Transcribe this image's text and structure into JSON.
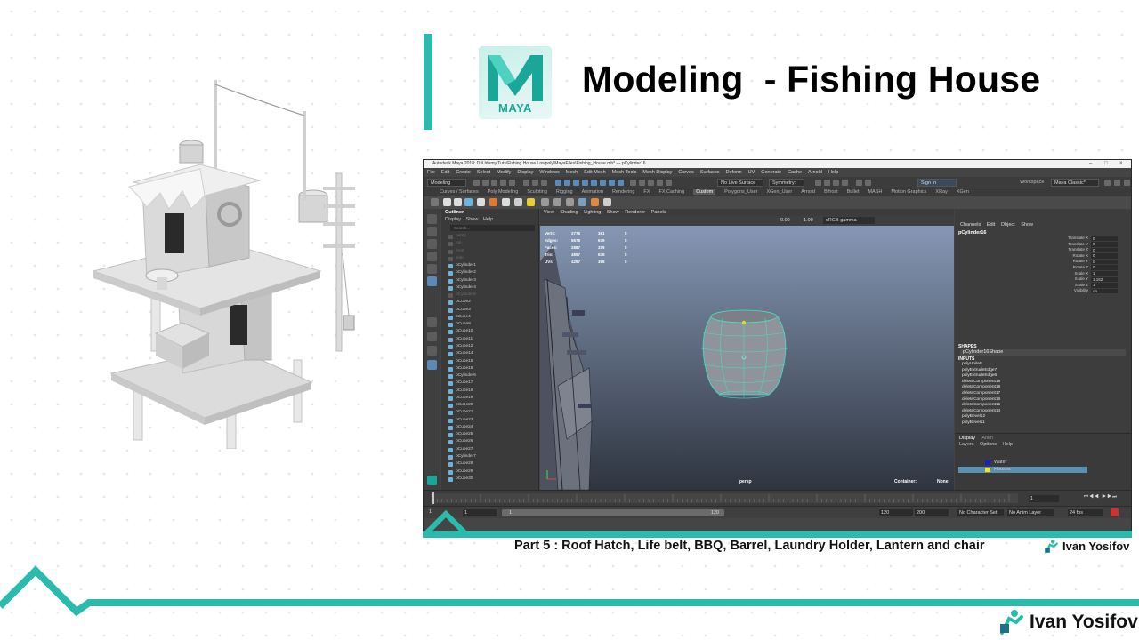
{
  "slide": {
    "title": "Modeling  - Fishing House",
    "logo_text": "MAYA",
    "part_caption": "Part 5 : Roof Hatch, Life belt, BBQ, Barrel, Laundry Holder, Lantern and chair",
    "author": "Ivan Yosifov",
    "accent_color": "#2bbbad"
  },
  "maya": {
    "window_title": "Autodesk Maya 2018: D:\\Udemy Tuts\\Fishing House Lowpoly\\MayaFiles\\Fishing_House.mb* --- pCylinder16",
    "menubar": [
      "File",
      "Edit",
      "Create",
      "Select",
      "Modify",
      "Display",
      "Windows",
      "Mesh",
      "Edit Mesh",
      "Mesh Tools",
      "Mesh Display",
      "Curves",
      "Surfaces",
      "Deform",
      "UV",
      "Generate",
      "Cache",
      "Arnold",
      "Help"
    ],
    "status": {
      "mode": "Modeling",
      "live_surface": "No Live Surface",
      "symmetry": "Symmetry: Off",
      "sign_in": "Sign In",
      "workspace_label": "Workspace :",
      "workspace": "Maya Classic*"
    },
    "shelf_tabs": [
      "Curves / Surfaces",
      "Poly Modeling",
      "Sculpting",
      "Rigging",
      "Animation",
      "Rendering",
      "FX",
      "FX Caching",
      "Custom",
      "Polygons_User",
      "XGen_User",
      "Arnold",
      "Bifrost",
      "Bullet",
      "MASH",
      "Motion Graphics",
      "XRay",
      "XGen"
    ],
    "active_shelf": "Custom",
    "outliner": {
      "title": "Outliner",
      "menu": [
        "Display",
        "Show",
        "Help"
      ],
      "search_placeholder": "Search...",
      "items": [
        "persp",
        "top",
        "front",
        "side",
        "pCylinder1",
        "pCylinder2",
        "pCylinder3",
        "pCylinder4",
        "pCylinder5",
        "pCube2",
        "pCube3",
        "pCube4",
        "pCube8",
        "pCube10",
        "pCube11",
        "pCube12",
        "pCube14",
        "pCube15",
        "pCube16",
        "pCylinder6",
        "pCube17",
        "pCube18",
        "pCube19",
        "pCube20",
        "pCube21",
        "pCube22",
        "pCube24",
        "pCube25",
        "pCube26",
        "pCube27",
        "pCylinder7",
        "pCube28",
        "pCube29",
        "pCube30"
      ],
      "dim_items": [
        "persp",
        "top",
        "front",
        "side",
        "pCylinder5"
      ]
    },
    "viewport": {
      "menu": [
        "View",
        "Shading",
        "Lighting",
        "Show",
        "Renderer",
        "Panels"
      ],
      "gamma_value_1": "0.00",
      "gamma_value_2": "1.00",
      "color_space": "sRGB gamma",
      "hud": [
        {
          "label": "Verts:",
          "a": "2776",
          "b": "361",
          "c": "0"
        },
        {
          "label": "Edges:",
          "a": "5578",
          "b": "679",
          "c": "0"
        },
        {
          "label": "Faces:",
          "a": "2887",
          "b": "319",
          "c": "0"
        },
        {
          "label": "Tris:",
          "a": "4897",
          "b": "638",
          "c": "0"
        },
        {
          "label": "UVs:",
          "a": "4297",
          "b": "368",
          "c": "0"
        }
      ],
      "camera": "persp",
      "container_label": "Container:",
      "container_value": "None"
    },
    "channel_box": {
      "menu": [
        "Channels",
        "Edit",
        "Object",
        "Show"
      ],
      "object": "pCylinder16",
      "attributes": [
        {
          "name": "Translate X",
          "value": "0"
        },
        {
          "name": "Translate Y",
          "value": "0"
        },
        {
          "name": "Translate Z",
          "value": "0"
        },
        {
          "name": "Rotate X",
          "value": "0"
        },
        {
          "name": "Rotate Y",
          "value": "0"
        },
        {
          "name": "Rotate Z",
          "value": "0"
        },
        {
          "name": "Scale X",
          "value": "1"
        },
        {
          "name": "Scale Y",
          "value": "1.152"
        },
        {
          "name": "Scale Z",
          "value": "1"
        },
        {
          "name": "Visibility",
          "value": "on"
        }
      ],
      "shapes_label": "SHAPES",
      "shape_name": "pCylinder16Shape",
      "inputs_label": "INPUTS",
      "inputs": [
        "polyUnite8",
        "polyExtrudeEdge7",
        "polyExtrudeEdge6",
        "deleteComponent19",
        "deleteComponent18",
        "deleteComponent17",
        "deleteComponent16",
        "deleteComponent15",
        "deleteComponent14",
        "polyBevel12",
        "polyBevel11"
      ]
    },
    "layer_editor": {
      "tabs": [
        "Display",
        "Anim"
      ],
      "menu": [
        "Layers",
        "Options",
        "Help"
      ],
      "layers": [
        {
          "name": "Water",
          "color": "#1a1ad9",
          "selected": false
        },
        {
          "name": "Houses",
          "color": "#e6e633",
          "selected": true
        }
      ]
    },
    "time": {
      "current_frame": "1",
      "start": "1",
      "range_start": "1",
      "range_end": "120",
      "end": "120",
      "max_end": "200",
      "character_set": "No Character Set",
      "anim_layer": "No Anim Layer",
      "fps": "24 fps"
    }
  }
}
